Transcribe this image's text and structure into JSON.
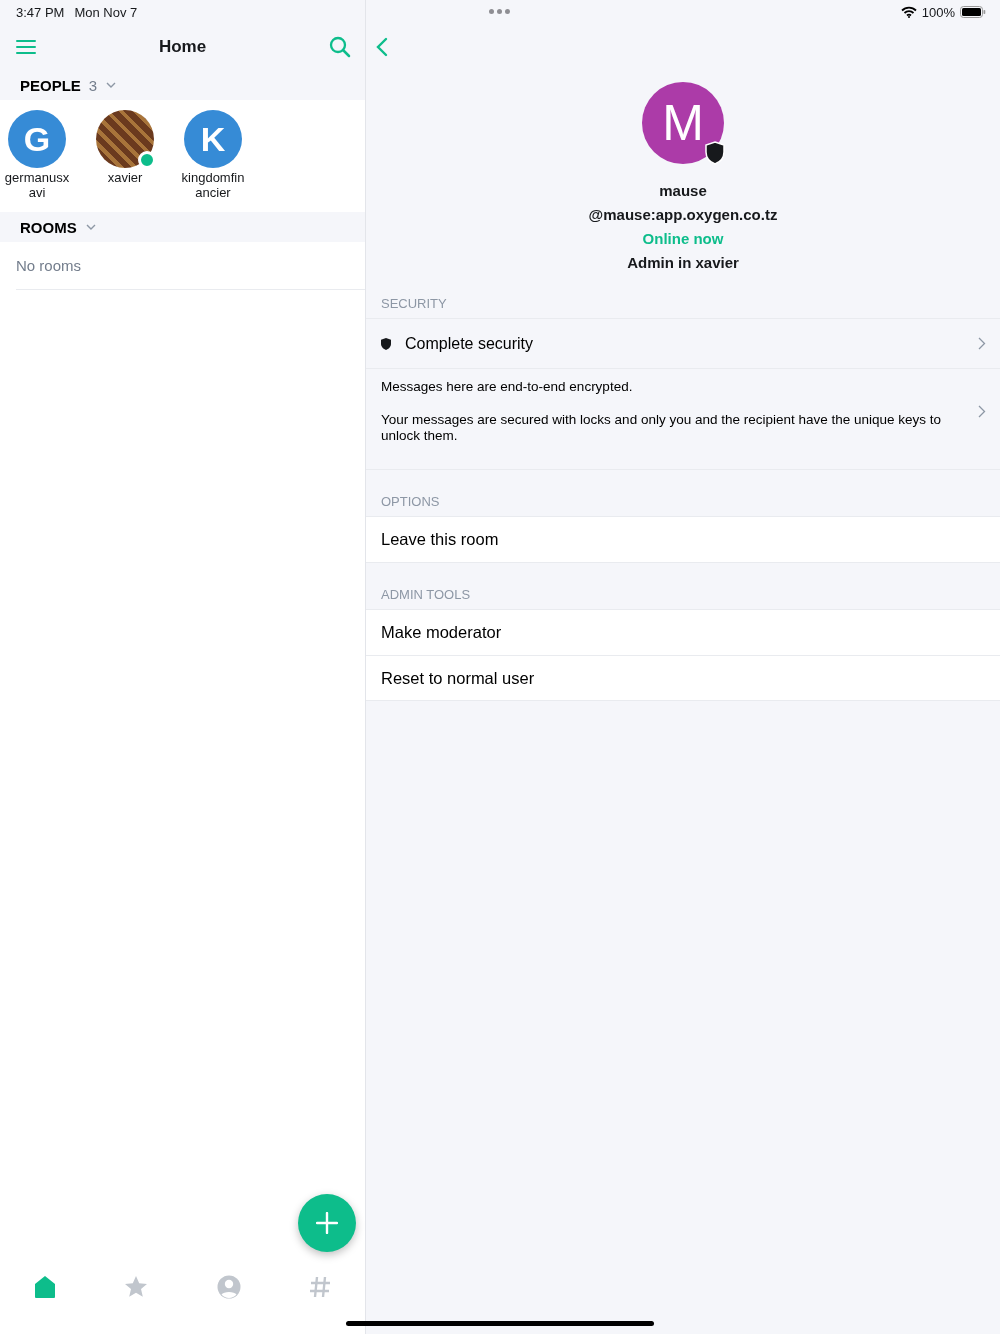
{
  "status_bar": {
    "time": "3:47 PM",
    "date": "Mon Nov 7",
    "battery": "100%"
  },
  "home": {
    "title": "Home",
    "people_section": {
      "label": "PEOPLE",
      "count": "3",
      "expanded": true
    },
    "people": [
      {
        "kind": "letter",
        "initial": "G",
        "name": "germanusxavi",
        "color": "#368bd6",
        "online": false
      },
      {
        "kind": "photo",
        "name": "xavier",
        "online": true
      },
      {
        "kind": "letter",
        "initial": "K",
        "name": "kingdomfinancier",
        "color": "#368bd6",
        "online": false
      }
    ],
    "rooms_section": {
      "label": "ROOMS",
      "expanded": true
    },
    "rooms_empty": "No rooms",
    "tabs": [
      {
        "kind": "home",
        "selected": true
      },
      {
        "kind": "favourites",
        "selected": false
      },
      {
        "kind": "people",
        "selected": false
      },
      {
        "kind": "rooms",
        "selected": false
      }
    ]
  },
  "profile": {
    "initial": "M",
    "color": "#ac3ba8",
    "name": "mause",
    "user_id": "@mause:app.oxygen.co.tz",
    "presence": "Online now",
    "role": "Admin in xavier",
    "sections": [
      {
        "title": "SECURITY",
        "items": [
          {
            "kind": "security",
            "label": "Complete security"
          },
          {
            "kind": "note",
            "paragraphs": [
              "Messages here are end-to-end encrypted.",
              "Your messages are secured with locks and only you and the recipient have the unique keys to unlock them."
            ]
          }
        ]
      },
      {
        "title": "OPTIONS",
        "items": [
          {
            "kind": "action",
            "label": "Leave this room"
          }
        ]
      },
      {
        "title": "ADMIN TOOLS",
        "items": [
          {
            "kind": "action",
            "label": "Make moderator"
          },
          {
            "kind": "action",
            "label": "Reset to normal user"
          }
        ]
      }
    ]
  }
}
